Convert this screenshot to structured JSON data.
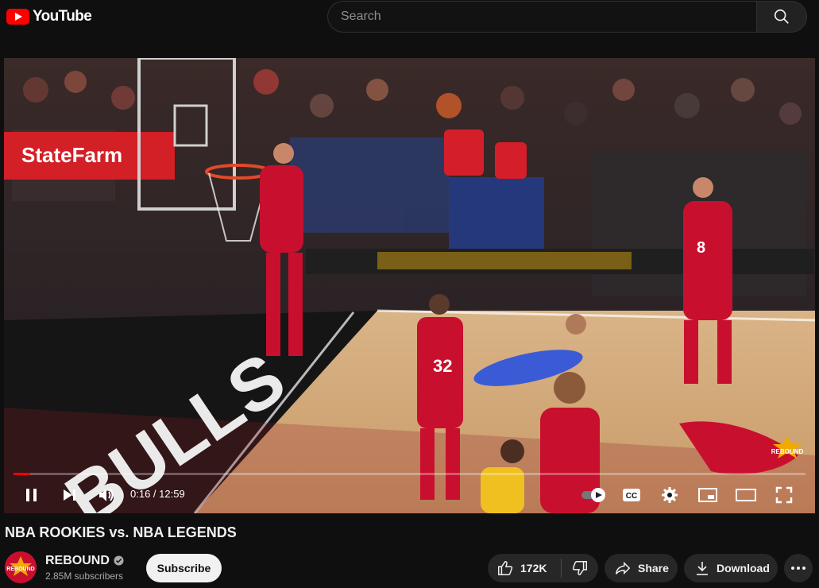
{
  "header": {
    "logo_text": "YouTube",
    "search_placeholder": "Search",
    "icons": {
      "logo": "youtube-play-icon",
      "search": "search-icon"
    }
  },
  "player": {
    "current_time": "0:16",
    "duration": "12:59",
    "time_display": "0:16 / 12:59",
    "progress": 0.021,
    "scene_text": {
      "sponsor": "StateFarm",
      "court": "BULLS",
      "jersey_1": "32",
      "jersey_2": "8",
      "watermark": "REBOUND"
    },
    "icons": [
      "pause-icon",
      "next-icon",
      "volume-icon",
      "autoplay-toggle-icon",
      "captions-icon",
      "settings-icon",
      "miniplayer-icon",
      "theater-icon",
      "fullscreen-icon"
    ],
    "captions_label": "CC"
  },
  "video": {
    "title": "NBA ROOKIES vs. NBA LEGENDS",
    "channel_name": "REBOUND",
    "subscribers": "2.85M subscribers",
    "subscribe_label": "Subscribe",
    "avatar_text": "REBOUND",
    "like_count": "172K",
    "share_label": "Share",
    "download_label": "Download"
  },
  "colors": {
    "accent": "#ff0000",
    "background": "#0f0f0f",
    "pill": "#272727",
    "bulls_red": "#c8102e"
  }
}
